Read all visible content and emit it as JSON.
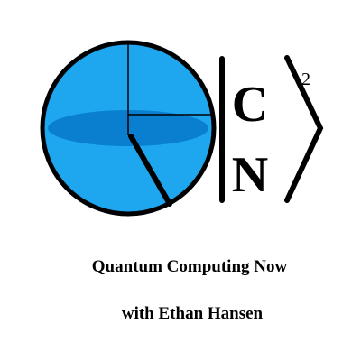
{
  "logo": {
    "letters": {
      "top": "C",
      "bottom": "N",
      "superscript": "2"
    },
    "colors": {
      "sphere": "#1ea6ee",
      "equator": "#0a7fcf",
      "ink": "#000000"
    }
  },
  "caption": {
    "title": "Quantum Computing Now",
    "subtitle": "with Ethan Hansen"
  }
}
